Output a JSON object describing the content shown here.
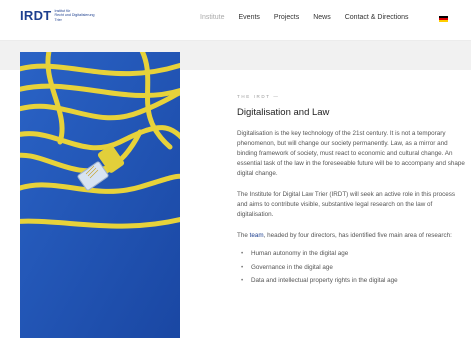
{
  "header": {
    "logo": {
      "mark": "IRDT",
      "sub": [
        "Institut für",
        "Recht und Digitalisierung",
        "Trier"
      ]
    },
    "nav": [
      {
        "label": "Institute",
        "active": true
      },
      {
        "label": "Events",
        "active": false
      },
      {
        "label": "Projects",
        "active": false
      },
      {
        "label": "News",
        "active": false
      },
      {
        "label": "Contact & Directions",
        "active": false
      }
    ],
    "language_flag": "german-flag-icon"
  },
  "colors": {
    "brand": "#1d3f8f",
    "photo_background": "#1f55b8",
    "cable": "#e7d23a"
  },
  "main": {
    "eyebrow": "The IRDT —",
    "title": "Digitalisation and Law",
    "paragraphs": [
      "Digitalisation is the key technology of the 21st century. It is not a temporary phenomenon, but will change our society permanently. Law, as a mirror and binding framework of society, must react to economic and cultural change. An essential task of the law in the foreseeable future will be to accompany and shape digital change.",
      "The Institute for Digital Law Trier (IRDT) will seek an active role in this process and aims to contribute visible, substantive legal research on the law of digitalisation."
    ],
    "team_link": "team",
    "team_pre": "The ",
    "team_post": ", headed by four directors, has identified five main area of research:",
    "research_areas": [
      "Human autonomy in the digital age",
      "Governance in the digital age",
      "Data and intellectual property rights in the digital age"
    ]
  }
}
